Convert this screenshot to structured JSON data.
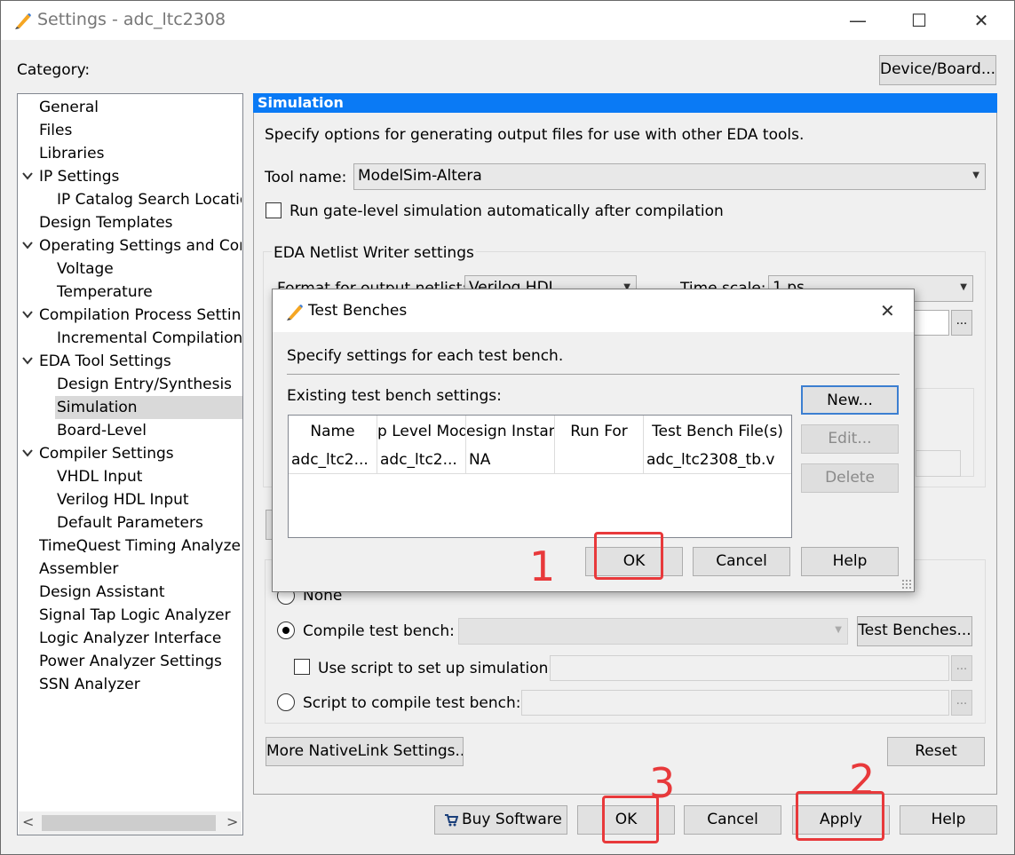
{
  "window": {
    "title": "Settings - adc_ltc2308",
    "minimize_glyph": "—",
    "maximize_glyph": "☐",
    "close_glyph": "✕"
  },
  "category_label": "Category:",
  "device_board_button": "Device/Board...",
  "tree": {
    "items": [
      "General",
      "Files",
      "Libraries",
      "IP Settings",
      "IP Catalog Search Location",
      "Design Templates",
      "Operating Settings and Conditions",
      "Voltage",
      "Temperature",
      "Compilation Process Settings",
      "Incremental Compilation",
      "EDA Tool Settings",
      "Design Entry/Synthesis",
      "Simulation",
      "Board-Level",
      "Compiler Settings",
      "VHDL Input",
      "Verilog HDL Input",
      "Default Parameters",
      "TimeQuest Timing Analyzer",
      "Assembler",
      "Design Assistant",
      "Signal Tap Logic Analyzer",
      "Logic Analyzer Interface",
      "Power Analyzer Settings",
      "SSN Analyzer"
    ],
    "selected": "Simulation",
    "scroll_left": "<",
    "scroll_right": ">"
  },
  "simulation": {
    "header": "Simulation",
    "description": "Specify options for generating output files for use with other EDA tools.",
    "tool_name_label": "Tool name:",
    "tool_name_value": "ModelSim-Altera",
    "gate_level_label": "Run gate-level simulation automatically after compilation",
    "eda_group_label": "EDA Netlist Writer settings",
    "format_label": "Format for output netlist:",
    "format_value": "Verilog HDL",
    "time_scale_label": "Time scale:",
    "time_scale_value": "1 ps",
    "browse_label": "...",
    "none_label": "None",
    "compile_tb_label": "Compile test bench:",
    "test_benches_button": "Test Benches...",
    "use_script_label": "Use script to set up simulation:",
    "script_compile_label": "Script to compile test bench:",
    "more_nativelink_button": "More NativeLink Settings...",
    "reset_button": "Reset"
  },
  "footer": {
    "buy_software": "Buy Software",
    "ok": "OK",
    "cancel": "Cancel",
    "apply": "Apply",
    "help": "Help"
  },
  "dialog": {
    "title": "Test Benches",
    "close_glyph": "✕",
    "description": "Specify settings for each test bench.",
    "existing_label": "Existing test bench settings:",
    "columns": [
      "Name",
      "p Level Mod",
      "esign Instan",
      "Run For",
      "Test Bench File(s)"
    ],
    "rows": [
      [
        "adc_ltc2...",
        "adc_ltc2...",
        "NA",
        "",
        "adc_ltc2308_tb.v"
      ]
    ],
    "new_button": "New...",
    "edit_button": "Edit...",
    "delete_button": "Delete",
    "ok_button": "OK",
    "cancel_button": "Cancel",
    "help_button": "Help"
  },
  "annotations": {
    "colors": {
      "red": "#e8393b"
    },
    "step1": "1",
    "step2": "2",
    "step3": "3"
  },
  "colors": {
    "accent": "#0a7af5",
    "selection": "#d9d9d9"
  }
}
